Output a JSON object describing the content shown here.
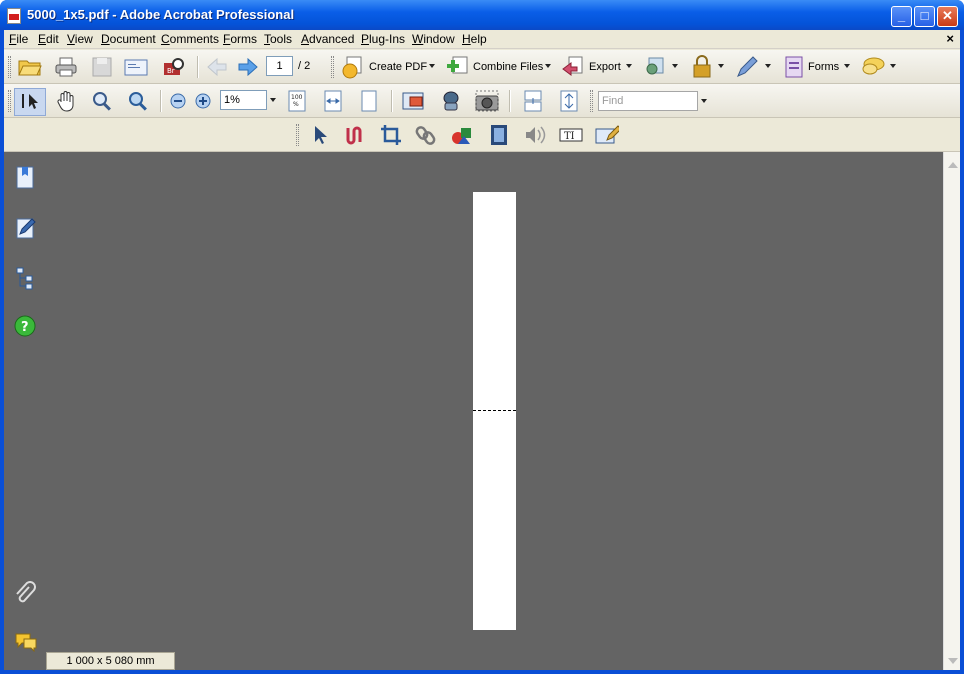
{
  "window": {
    "title": "5000_1x5.pdf - Adobe Acrobat Professional"
  },
  "menubar": {
    "items": [
      "File",
      "Edit",
      "View",
      "Document",
      "Comments",
      "Forms",
      "Tools",
      "Advanced",
      "Plug-Ins",
      "Window",
      "Help"
    ],
    "close_glyph": "×"
  },
  "toolbar": {
    "page_current": "1",
    "page_total": "/ 2",
    "create_pdf": "Create PDF",
    "combine_files": "Combine Files",
    "export": "Export",
    "forms": "Forms",
    "zoom": "1%",
    "find_placeholder": "Find"
  },
  "status": {
    "page_size": "1 000 x 5 080 mm"
  },
  "colors": {
    "titlebar": "#0a5ee8",
    "doc_bg": "#646464",
    "chrome": "#ece9d8"
  },
  "icons": [
    "folder-open-icon",
    "print-icon",
    "save-icon",
    "email-icon",
    "organizer-icon",
    "prev-page-icon",
    "next-page-icon",
    "create-pdf-icon",
    "combine-files-icon",
    "export-icon",
    "review-icon",
    "secure-icon",
    "sign-icon",
    "forms-icon",
    "comment-icon",
    "select-tool-icon",
    "hand-tool-icon",
    "marquee-zoom-icon",
    "dynamic-zoom-icon",
    "zoom-out-icon",
    "zoom-in-icon",
    "actual-size-icon",
    "fit-width-icon",
    "fit-page-icon",
    "pan-zoom-icon",
    "loupe-icon",
    "snapshot-icon",
    "single-page-icon",
    "continuous-icon",
    "bookmarks-icon",
    "signatures-icon",
    "model-tree-icon",
    "help-icon",
    "attachments-icon",
    "comments-icon"
  ]
}
